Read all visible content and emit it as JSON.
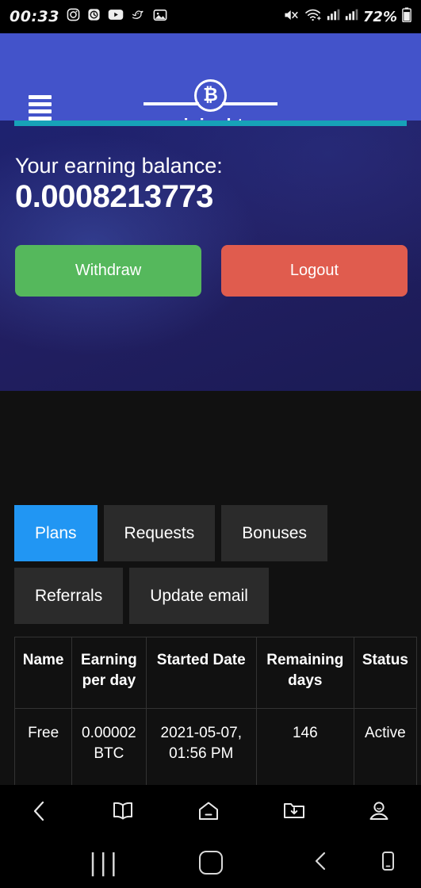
{
  "status_bar": {
    "time": "00:33",
    "battery_percent": "72%",
    "left_icons": [
      "instagram-icon",
      "clock-icon",
      "youtube-icon",
      "bird-app-icon",
      "gallery-icon"
    ],
    "right_icons": [
      "mute-icon",
      "wifi-icon",
      "signal-sim1-icon",
      "signal-sim2-icon",
      "battery-icon"
    ]
  },
  "header": {
    "menu_icon": "hamburger-menu-icon",
    "logo_symbol": "₿",
    "brand_name": "miningbtc",
    "background_color": "#4353ca"
  },
  "hero": {
    "balance_label": "Your earning balance:",
    "balance_value": "0.0008213773",
    "info_bar_color": "#17a2b8",
    "withdraw_label": "Withdraw",
    "withdraw_color": "#55b85c",
    "logout_label": "Logout",
    "logout_color": "#e05c4e"
  },
  "tabs": {
    "active": "Plans",
    "active_color": "#2196f3",
    "items": [
      {
        "label": "Plans"
      },
      {
        "label": "Requests"
      },
      {
        "label": "Bonuses"
      },
      {
        "label": "Referrals"
      },
      {
        "label": "Update email"
      }
    ]
  },
  "plans_table": {
    "columns": [
      "Name",
      "Earning per day",
      "Started Date",
      "Remaining days",
      "Status"
    ],
    "columns_split": [
      {
        "line1": "Name",
        "line2": ""
      },
      {
        "line1": "Earning",
        "line2": "per day"
      },
      {
        "line1": "Started Date",
        "line2": ""
      },
      {
        "line1": "Remaining",
        "line2": "days"
      },
      {
        "line1": "Status",
        "line2": ""
      }
    ],
    "rows": [
      {
        "name": "Free",
        "earning_per_day_line1": "0.00002",
        "earning_per_day_line2": "BTC",
        "started_date_line1": "2021-05-07,",
        "started_date_line2": "01:56 PM",
        "remaining_days": "146",
        "status": "Active"
      }
    ]
  },
  "browser_toolbar": {
    "items": [
      {
        "name": "back-icon"
      },
      {
        "name": "bookmarks-book-icon"
      },
      {
        "name": "home-icon"
      },
      {
        "name": "downloads-folder-icon"
      },
      {
        "name": "profile-person-icon"
      }
    ]
  },
  "system_nav": {
    "recents": "|||",
    "items": [
      {
        "name": "recents-icon"
      },
      {
        "name": "home-square-icon"
      },
      {
        "name": "back-chevron-icon"
      },
      {
        "name": "device-icon"
      }
    ]
  }
}
